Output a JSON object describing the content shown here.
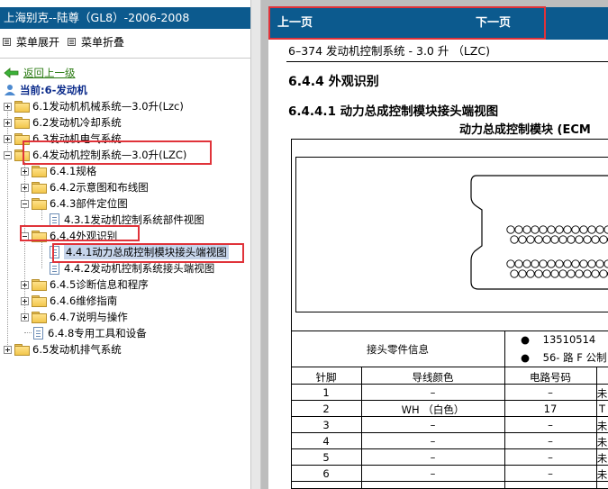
{
  "window": {
    "title": "上海别克--陆尊（GL8）-2006-2008"
  },
  "menu": {
    "expand_label": "菜单展开",
    "collapse_label": "菜单折叠"
  },
  "tree": {
    "back_label": "返回上一级",
    "current_label": "当前:6-发动机",
    "items": [
      {
        "label": "6.1发动机机械系统—3.0升(Lzc)"
      },
      {
        "label": "6.2发动机冷却系统"
      },
      {
        "label": "6.3发动机电气系统"
      },
      {
        "label": "6.4发动机控制系统—3.0升(LZC)"
      },
      {
        "label": "6.4.1规格"
      },
      {
        "label": "6.4.2示意图和布线图"
      },
      {
        "label": "6.4.3部件定位图"
      },
      {
        "label": "4.3.1发动机控制系统部件视图"
      },
      {
        "label": "6.4.4外观识别"
      },
      {
        "label": "4.4.1动力总成控制模块接头端视图"
      },
      {
        "label": "4.4.2发动机控制系统接头端视图"
      },
      {
        "label": "6.4.5诊断信息和程序"
      },
      {
        "label": "6.4.6维修指南"
      },
      {
        "label": "6.4.7说明与操作"
      },
      {
        "label": "6.4.8专用工具和设备"
      },
      {
        "label": "6.5发动机排气系统"
      }
    ]
  },
  "nav": {
    "prev_label": "上一页",
    "next_label": "下一页"
  },
  "doc": {
    "page_header": "6–374    发动机控制系统 - 3.0 升 （LZC)",
    "section_title": "6.4.4 外观识别",
    "subsection_title": "6.4.4.1 动力总成控制模块接头端视图",
    "figure_title": "动力总成控制模块 (ECM",
    "connector_info_label": "接头零件信息",
    "connector_bullets": [
      "13510514",
      "56- 路 F 公制"
    ],
    "table": {
      "headers": [
        "针脚",
        "导线颜色",
        "电路号码"
      ],
      "rows": [
        {
          "pin": "1",
          "color": "–",
          "circuit": "–",
          "fn": "未"
        },
        {
          "pin": "2",
          "color": "WH （白色）",
          "circuit": "17",
          "fn": "T"
        },
        {
          "pin": "3",
          "color": "–",
          "circuit": "–",
          "fn": "未"
        },
        {
          "pin": "4",
          "color": "–",
          "circuit": "–",
          "fn": "未"
        },
        {
          "pin": "5",
          "color": "–",
          "circuit": "–",
          "fn": "未"
        },
        {
          "pin": "6",
          "color": "–",
          "circuit": "–",
          "fn": "未"
        }
      ]
    }
  },
  "colors": {
    "titlebar": "#0c5a8e",
    "highlight_box": "#e0333a",
    "selection": "#c6d4ea"
  }
}
